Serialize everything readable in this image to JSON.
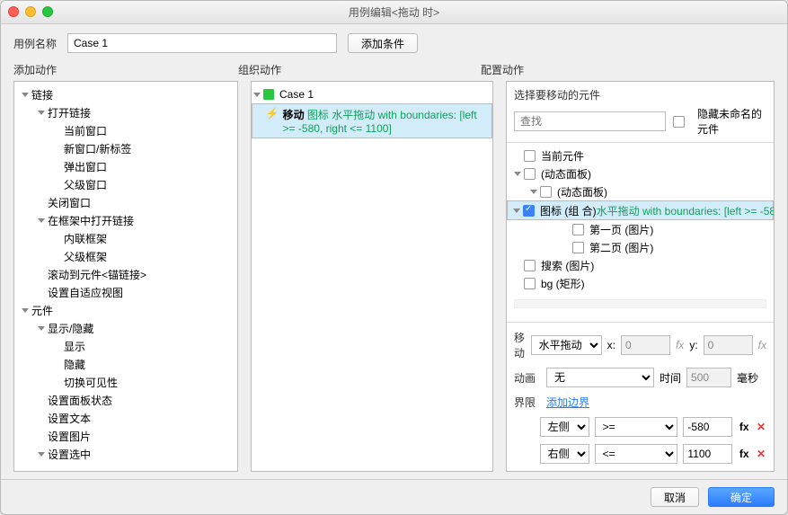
{
  "window": {
    "title": "用例编辑<拖动 时>"
  },
  "toprow": {
    "name_label": "用例名称",
    "name_value": "Case 1",
    "add_condition": "添加条件"
  },
  "cols": {
    "left": "添加动作",
    "mid": "组织动作",
    "right": "配置动作"
  },
  "left_tree": [
    {
      "lvl": 0,
      "disc": "open",
      "text": "链接"
    },
    {
      "lvl": 1,
      "disc": "open",
      "text": "打开链接"
    },
    {
      "lvl": 2,
      "disc": "none",
      "text": "当前窗口"
    },
    {
      "lvl": 2,
      "disc": "none",
      "text": "新窗口/新标签"
    },
    {
      "lvl": 2,
      "disc": "none",
      "text": "弹出窗口"
    },
    {
      "lvl": 2,
      "disc": "none",
      "text": "父级窗口"
    },
    {
      "lvl": 1,
      "disc": "none",
      "text": "关闭窗口"
    },
    {
      "lvl": 1,
      "disc": "open",
      "text": "在框架中打开链接"
    },
    {
      "lvl": 2,
      "disc": "none",
      "text": "内联框架"
    },
    {
      "lvl": 2,
      "disc": "none",
      "text": "父级框架"
    },
    {
      "lvl": 1,
      "disc": "none",
      "text": "滚动到元件<锚链接>"
    },
    {
      "lvl": 1,
      "disc": "none",
      "text": "设置自适应视图"
    },
    {
      "lvl": 0,
      "disc": "open",
      "text": "元件"
    },
    {
      "lvl": 1,
      "disc": "open",
      "text": "显示/隐藏"
    },
    {
      "lvl": 2,
      "disc": "none",
      "text": "显示"
    },
    {
      "lvl": 2,
      "disc": "none",
      "text": "隐藏"
    },
    {
      "lvl": 2,
      "disc": "none",
      "text": "切换可见性"
    },
    {
      "lvl": 1,
      "disc": "none",
      "text": "设置面板状态"
    },
    {
      "lvl": 1,
      "disc": "none",
      "text": "设置文本"
    },
    {
      "lvl": 1,
      "disc": "none",
      "text": "设置图片"
    },
    {
      "lvl": 1,
      "disc": "open",
      "text": "设置选中"
    }
  ],
  "mid_tree": {
    "case_label": "Case 1",
    "action_prefix": "移动 ",
    "action_target": "图标 ",
    "action_desc": "水平拖动 with boundaries: [left >= -580, right <= 1100]"
  },
  "right": {
    "header": "选择要移动的元件",
    "search_placeholder": "查找",
    "hide_unnamed": "隐藏未命名的元件",
    "tree": [
      {
        "lvl": 0,
        "disc": "none",
        "chk": false,
        "text": "当前元件"
      },
      {
        "lvl": 0,
        "disc": "open",
        "chk": false,
        "text": "(动态面板)"
      },
      {
        "lvl": 1,
        "disc": "open",
        "chk": false,
        "text": "(动态面板)"
      },
      {
        "lvl": 2,
        "disc": "open",
        "chk": true,
        "text": "图标 (组 合) ",
        "green": "水平拖动 with boundaries: [left >= -58"
      },
      {
        "lvl": 3,
        "disc": "none",
        "chk": false,
        "text": "第一页 (图片)"
      },
      {
        "lvl": 3,
        "disc": "none",
        "chk": false,
        "text": "第二页 (图片)"
      },
      {
        "lvl": 0,
        "disc": "none",
        "chk": false,
        "text": "搜索 (图片)"
      },
      {
        "lvl": 0,
        "disc": "none",
        "chk": false,
        "text": "bg (矩形)"
      }
    ]
  },
  "form": {
    "move_label": "移动",
    "move_type": "水平拖动",
    "x_label": "x:",
    "x_val": "0",
    "y_label": "y:",
    "y_val": "0",
    "anim_label": "动画",
    "anim_val": "无",
    "time_label": "时间",
    "time_val": "500",
    "time_unit": "毫秒",
    "bounds_label": "界限",
    "bounds_link": "添加边界",
    "b1_side": "左侧",
    "b1_op": ">=",
    "b1_val": "-580",
    "b2_side": "右侧",
    "b2_op": "<=",
    "b2_val": "1100",
    "fx": "fx"
  },
  "footer": {
    "cancel": "取消",
    "ok": "确定"
  }
}
